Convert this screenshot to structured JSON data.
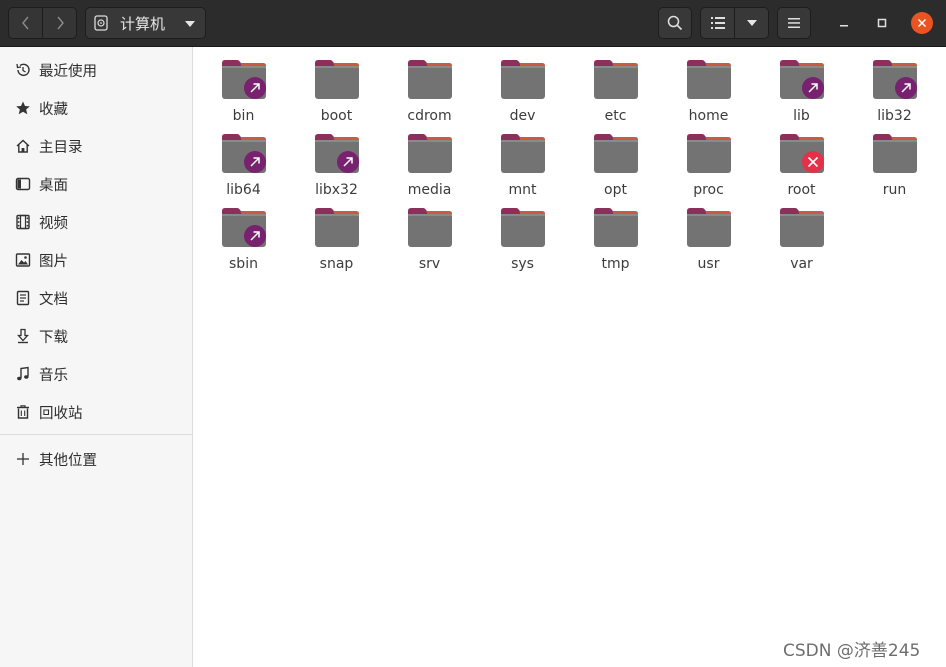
{
  "header": {
    "path_label": "计算机"
  },
  "sidebar": {
    "items": [
      {
        "label": "最近使用",
        "icon": "recent-icon"
      },
      {
        "label": "收藏",
        "icon": "star-icon"
      },
      {
        "label": "主目录",
        "icon": "home-icon"
      },
      {
        "label": "桌面",
        "icon": "desktop-icon"
      },
      {
        "label": "视频",
        "icon": "video-icon"
      },
      {
        "label": "图片",
        "icon": "picture-icon"
      },
      {
        "label": "文档",
        "icon": "document-icon"
      },
      {
        "label": "下载",
        "icon": "download-icon"
      },
      {
        "label": "音乐",
        "icon": "music-icon"
      },
      {
        "label": "回收站",
        "icon": "trash-icon"
      }
    ],
    "other_locations": {
      "label": "其他位置",
      "icon": "plus-icon"
    }
  },
  "files": [
    {
      "name": "bin",
      "emblem": "link"
    },
    {
      "name": "boot",
      "emblem": ""
    },
    {
      "name": "cdrom",
      "emblem": ""
    },
    {
      "name": "dev",
      "emblem": ""
    },
    {
      "name": "etc",
      "emblem": ""
    },
    {
      "name": "home",
      "emblem": ""
    },
    {
      "name": "lib",
      "emblem": "link"
    },
    {
      "name": "lib32",
      "emblem": "link"
    },
    {
      "name": "lib64",
      "emblem": "link"
    },
    {
      "name": "libx32",
      "emblem": "link"
    },
    {
      "name": "media",
      "emblem": ""
    },
    {
      "name": "mnt",
      "emblem": ""
    },
    {
      "name": "opt",
      "emblem": ""
    },
    {
      "name": "proc",
      "emblem": ""
    },
    {
      "name": "root",
      "emblem": "denied"
    },
    {
      "name": "run",
      "emblem": ""
    },
    {
      "name": "sbin",
      "emblem": "link"
    },
    {
      "name": "snap",
      "emblem": ""
    },
    {
      "name": "srv",
      "emblem": ""
    },
    {
      "name": "sys",
      "emblem": ""
    },
    {
      "name": "tmp",
      "emblem": ""
    },
    {
      "name": "usr",
      "emblem": ""
    },
    {
      "name": "var",
      "emblem": ""
    }
  ],
  "watermark": "CSDN @济善245",
  "colors": {
    "header_bg": "#2c2c2c",
    "folder_body": "#737373",
    "folder_tab": "#8c2f5a",
    "link_emblem": "#77216f",
    "denied_emblem": "#e5304a",
    "close_button": "#e95420"
  }
}
